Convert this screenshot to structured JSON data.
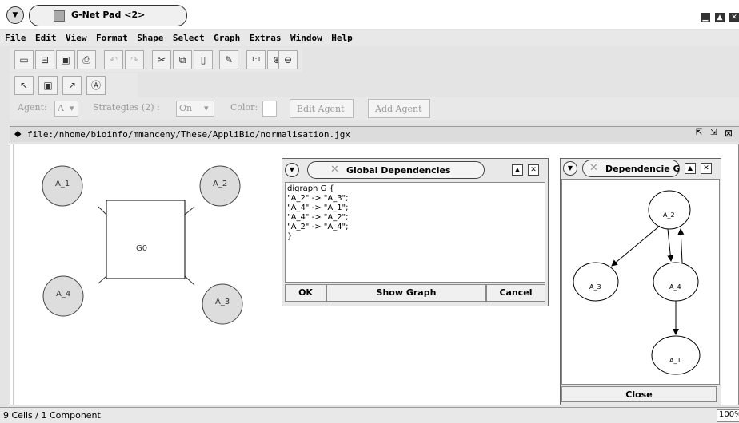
{
  "window": {
    "title": "G-Net Pad <2>"
  },
  "menubar": [
    "File",
    "Edit",
    "View",
    "Format",
    "Shape",
    "Select",
    "Graph",
    "Extras",
    "Window",
    "Help"
  ],
  "agentbar": {
    "agent_label": "Agent:",
    "agent_value": "A",
    "strategies_label": "Strategies (2) :",
    "strategies_value": "On",
    "color_label": "Color:",
    "edit_agent": "Edit Agent",
    "add_agent": "Add Agent"
  },
  "document": {
    "path": "file:/nhome/bioinfo/mmanceny/These/AppliBio/normalisation.jgx"
  },
  "graph": {
    "center": "G0",
    "nodes": [
      "A_1",
      "A_2",
      "A_3",
      "A_4"
    ]
  },
  "global_dialog": {
    "title": "Global Dependencies",
    "code": [
      "digraph G {",
      "\"A_2\" -> \"A_3\";",
      "\"A_4\" -> \"A_1\";",
      "\"A_4\" -> \"A_2\";",
      "\"A_2\" -> \"A_4\";",
      "}"
    ],
    "ok": "OK",
    "show_graph": "Show Graph",
    "cancel": "Cancel"
  },
  "dep_dialog": {
    "title": "Dependencie G",
    "nodes": [
      "A_2",
      "A_3",
      "A_4",
      "A_1"
    ],
    "close": "Close"
  },
  "statusbar": {
    "text": "9 Cells / 1 Component",
    "zoom": "100%"
  }
}
